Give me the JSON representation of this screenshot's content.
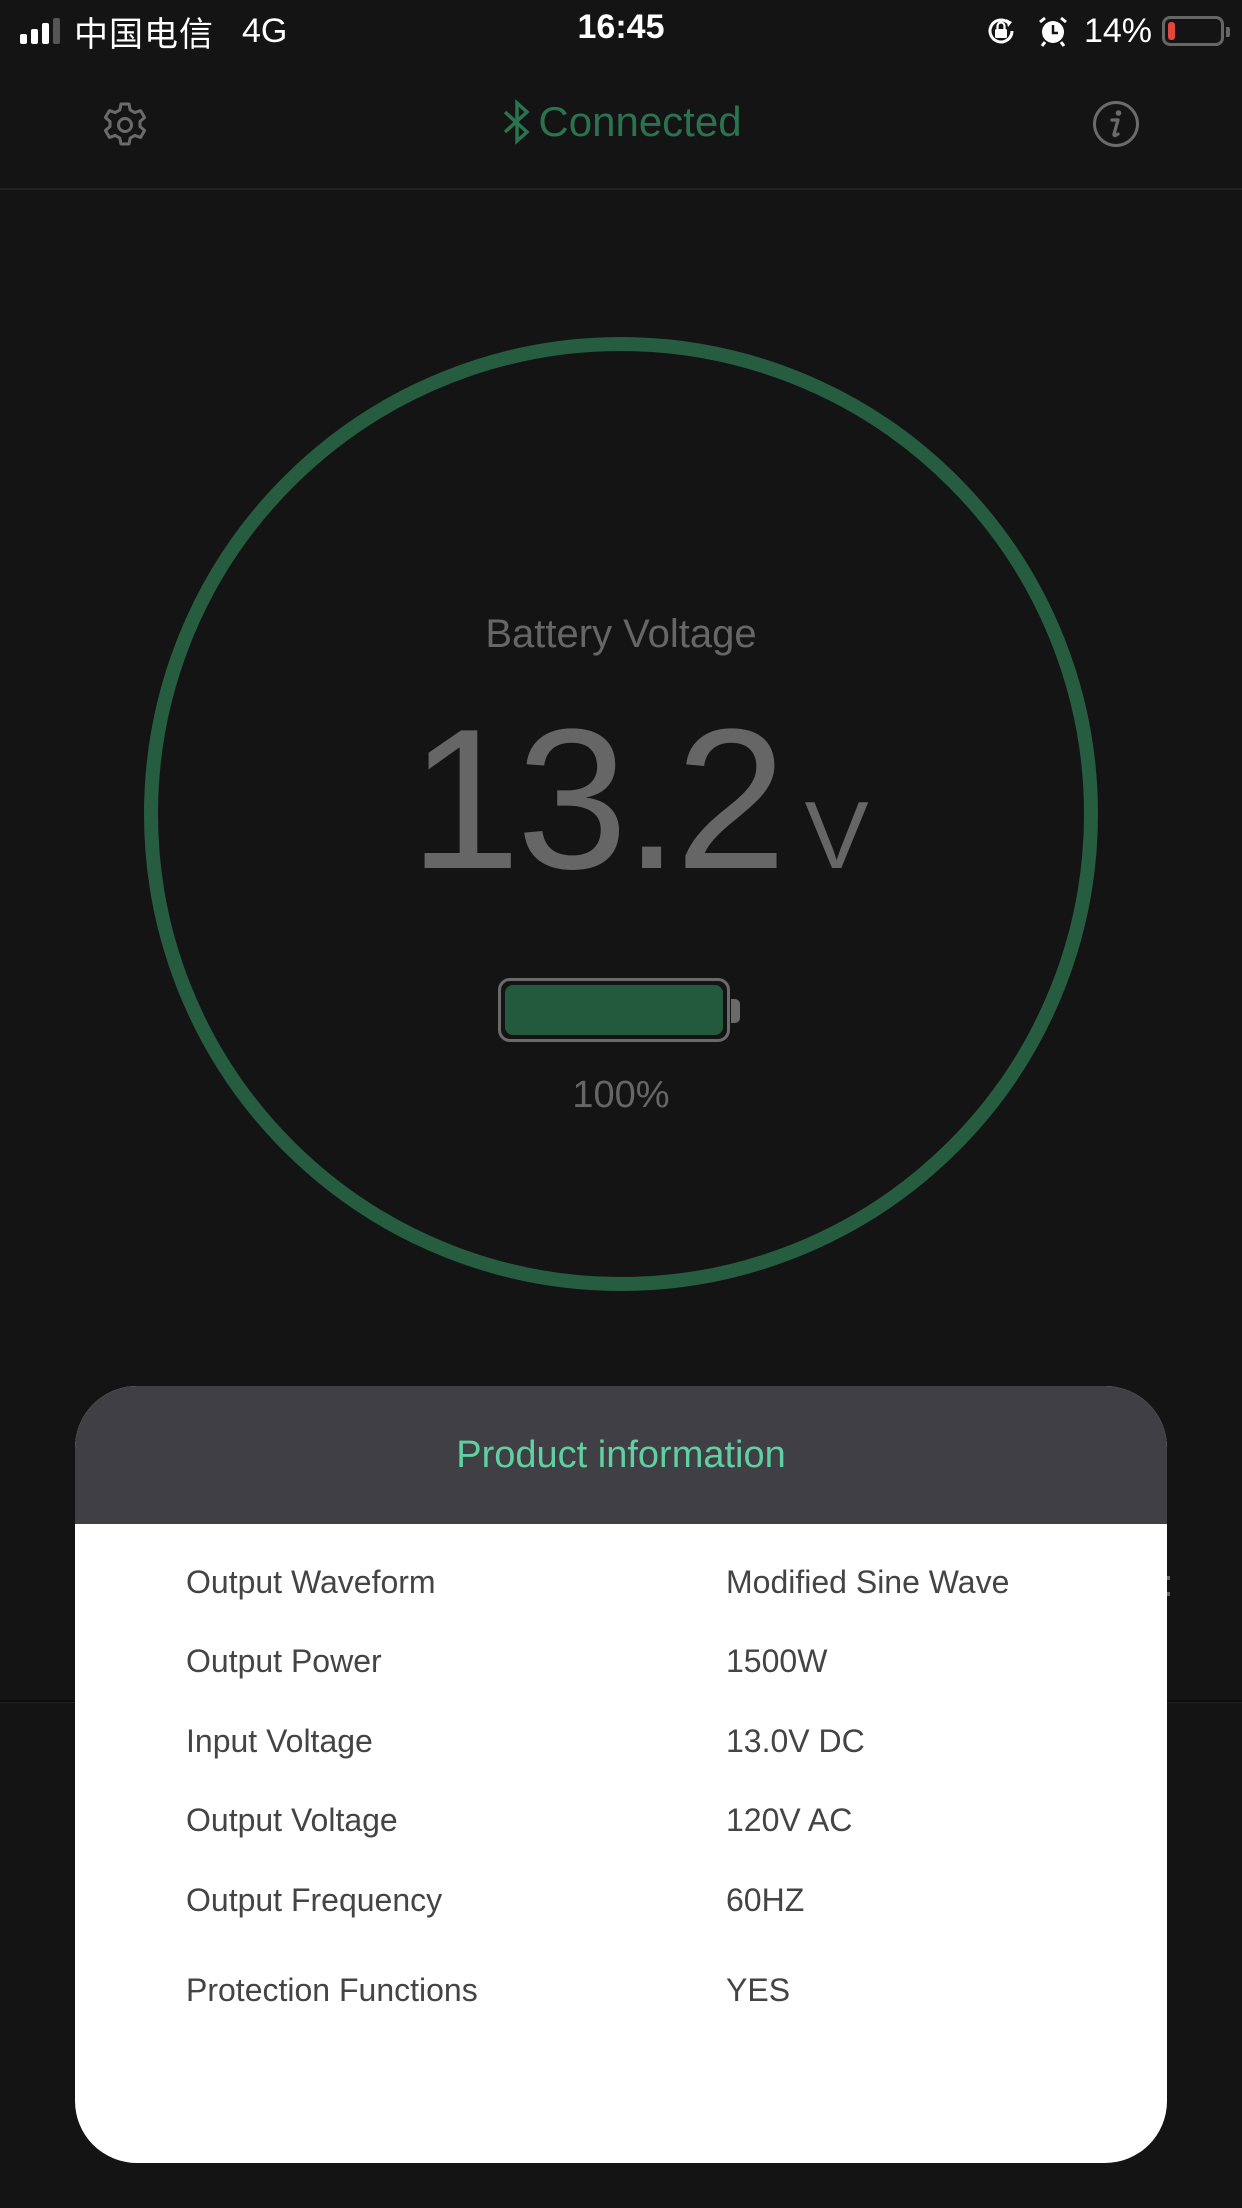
{
  "status_bar": {
    "carrier": "中国电信",
    "network": "4G",
    "time": "16:45",
    "signal_bars": 3,
    "signal_total": 4,
    "battery_percent_label": "14%",
    "battery_level": 0.14,
    "battery_color": "#e5463c",
    "icons": [
      "rotation-lock-icon",
      "alarm-icon"
    ]
  },
  "nav": {
    "connection_status": "Connected",
    "left_icon": "gear-icon",
    "center_icon": "bluetooth-icon",
    "right_icon": "info-icon",
    "accent_color": "#2a7250"
  },
  "gauge": {
    "title": "Battery Voltage",
    "value": "13.2",
    "unit": "V",
    "battery_percent_label": "100%",
    "battery_level": 1.0,
    "ring_color": "#265d40",
    "fill_color": "#235a3d"
  },
  "modal": {
    "title": "Product information",
    "title_color": "#5fd0a3",
    "rows": [
      {
        "label": "Output Waveform",
        "value": "Modified Sine Wave"
      },
      {
        "label": "Output Power",
        "value": "1500W"
      },
      {
        "label": "Input Voltage",
        "value": "13.0V DC"
      },
      {
        "label": "Output Voltage",
        "value": "120V AC"
      },
      {
        "label": "Output Frequency",
        "value": "60HZ"
      },
      {
        "label": "Protection Functions",
        "value": "YES"
      }
    ]
  }
}
